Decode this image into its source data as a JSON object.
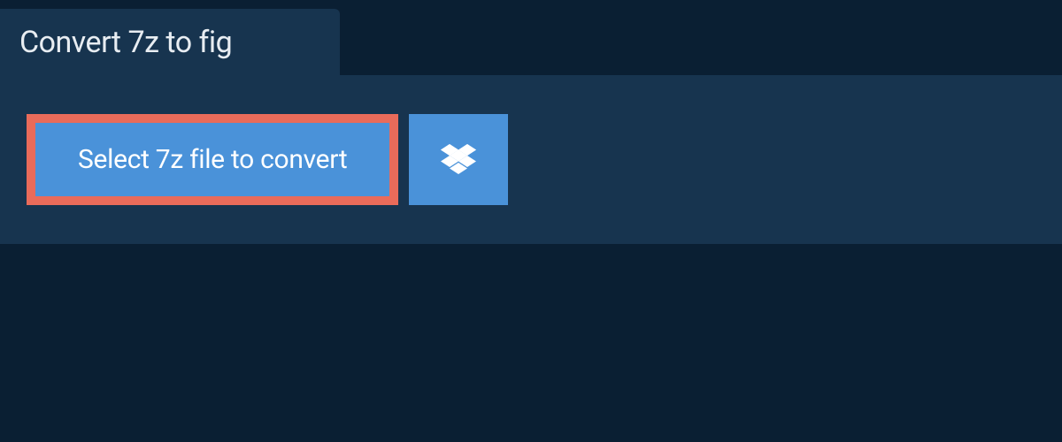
{
  "header": {
    "title": "Convert 7z to fig"
  },
  "actions": {
    "select_label": "Select 7z file to convert"
  },
  "colors": {
    "bg_dark": "#0a1f33",
    "bg_panel": "#17344f",
    "button_blue": "#4a92d9",
    "highlight_border": "#e96b5a",
    "text_light": "#e8edf2"
  }
}
